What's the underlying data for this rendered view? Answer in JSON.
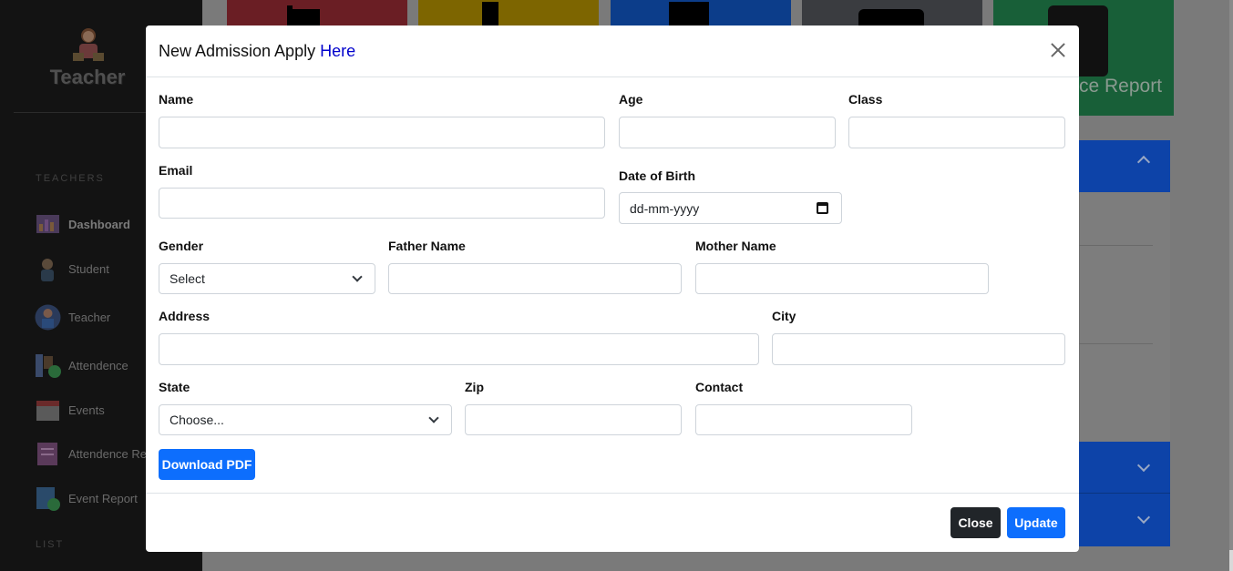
{
  "sidebar": {
    "brand": "Teacher",
    "section_teachers": "TEACHERS",
    "section_list": "LIST",
    "items": [
      {
        "label": "Dashboard",
        "icon": "dashboard-icon"
      },
      {
        "label": "Student",
        "icon": "student-icon"
      },
      {
        "label": "Teacher",
        "icon": "teacher-icon"
      },
      {
        "label": "Attendence",
        "icon": "attendance-icon"
      },
      {
        "label": "Events",
        "icon": "calendar-icon"
      },
      {
        "label": "Attendence Report",
        "icon": "attendance-report-icon"
      },
      {
        "label": "Event Report",
        "icon": "event-report-icon"
      }
    ]
  },
  "background": {
    "report_tile_label": "ce Report"
  },
  "modal": {
    "title": "New Admission Apply ",
    "title_accent": "Here",
    "fields": {
      "name": {
        "label": "Name",
        "value": ""
      },
      "age": {
        "label": "Age",
        "value": ""
      },
      "class": {
        "label": "Class",
        "value": ""
      },
      "email": {
        "label": "Email",
        "value": ""
      },
      "dob": {
        "label": "Date of Birth",
        "placeholder": "dd-mm-yyyy"
      },
      "gender": {
        "label": "Gender",
        "selected": "Select"
      },
      "father_name": {
        "label": "Father Name",
        "value": ""
      },
      "mother_name": {
        "label": "Mother Name",
        "value": ""
      },
      "address": {
        "label": "Address",
        "value": ""
      },
      "city": {
        "label": "City",
        "value": ""
      },
      "state": {
        "label": "State",
        "selected": "Choose..."
      },
      "zip": {
        "label": "Zip",
        "value": ""
      },
      "contact": {
        "label": "Contact",
        "value": ""
      }
    },
    "download_label": "Download PDF",
    "close_label": "Close",
    "update_label": "Update"
  },
  "colors": {
    "primary": "#0d6efd",
    "dark": "#212529",
    "title_accent": "#0000cc",
    "sidebar_bg": "#131313",
    "overlay": "#808080"
  }
}
